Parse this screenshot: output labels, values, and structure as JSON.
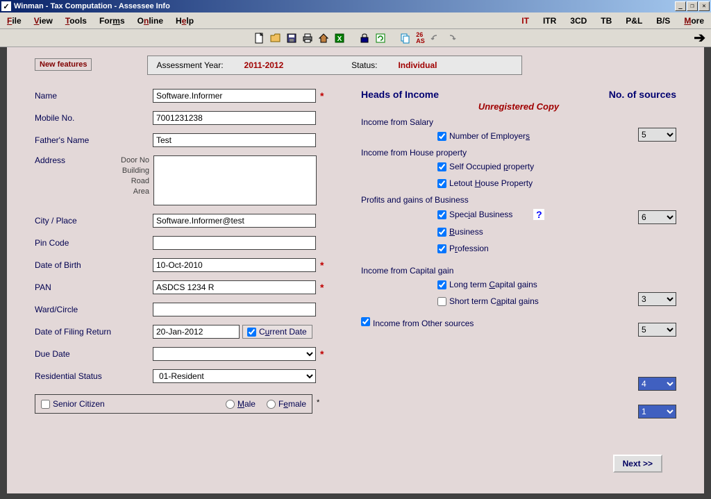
{
  "window": {
    "title": "Winman - Tax Computation - Assessee Info"
  },
  "menu": {
    "left": [
      "File",
      "View",
      "Tools",
      "Forms",
      "Online",
      "Help"
    ],
    "right": [
      "IT",
      "ITR",
      "3CD",
      "TB",
      "P&L",
      "B/S",
      "More"
    ]
  },
  "header": {
    "new_features": "New features",
    "ay_label": "Assessment Year:",
    "ay_value": "2011-2012",
    "status_label": "Status:",
    "status_value": "Individual"
  },
  "form": {
    "name_label": "Name",
    "name_value": "Software.Informer",
    "mobile_label": "Mobile No.",
    "mobile_value": "7001231238",
    "father_label": "Father's Name",
    "father_value": "Test",
    "address_label": "Address",
    "addr_sub_door": "Door No",
    "addr_sub_bld": "Building",
    "addr_sub_road": "Road",
    "addr_sub_area": "Area",
    "city_label": "City / Place",
    "city_value": "Software.Informer@test",
    "pin_label": "Pin Code",
    "pin_value": "",
    "dob_label": "Date of Birth",
    "dob_value": "10-Oct-2010",
    "pan_label": "PAN",
    "pan_value": "ASDCS 1234 R",
    "ward_label": "Ward/Circle",
    "ward_value": "",
    "filing_label": "Date of Filing Return",
    "filing_value": "20-Jan-2012",
    "current_date_label": "Current Date",
    "due_label": "Due Date",
    "due_value": "",
    "res_label": "Residential Status",
    "res_value": "01-Resident",
    "senior_label": "Senior Citizen",
    "male_label": "Male",
    "female_label": "Female"
  },
  "right": {
    "heads_label": "Heads of Income",
    "sources_label": "No. of sources",
    "unregistered": "Unregistered Copy",
    "salary_hd": "Income from Salary",
    "num_employers": "Number of Employers",
    "num_employers_val": "5",
    "house_hd": "Income from House property",
    "self_occ": "Self Occupied property",
    "letout": "Letout House Property",
    "letout_val": "6",
    "biz_hd": "Profits and gains of Business",
    "special": "Special Business",
    "business": "Business",
    "business_val": "3",
    "profession": "Profession",
    "profession_val": "5",
    "cap_hd": "Income from Capital gain",
    "ltcg": "Long term Capital gains",
    "ltcg_val": "4",
    "stcg": "Short term Capital gains",
    "stcg_val": "1",
    "other": "Income from Other sources",
    "next": "Next >>"
  }
}
